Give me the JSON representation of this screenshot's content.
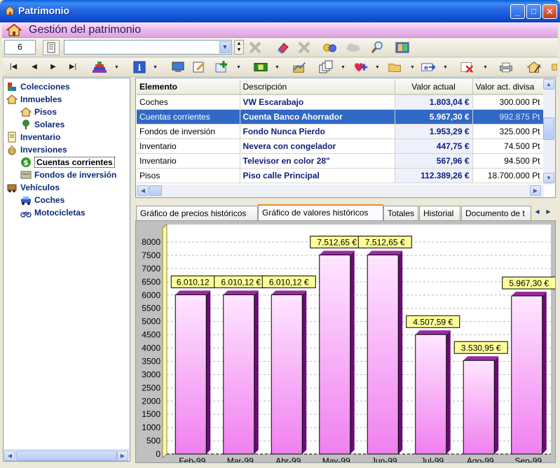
{
  "window": {
    "title": "Patrimonio",
    "min": "_",
    "max": "□",
    "close": "✕"
  },
  "header": {
    "title": "Gestión del patrimonio"
  },
  "toolbar1": {
    "count": "6",
    "combo_value": ""
  },
  "tree": {
    "items": [
      {
        "label": "Colecciones",
        "icon": "collections-icon",
        "level": 0
      },
      {
        "label": "Inmuebles",
        "icon": "house-icon",
        "level": 0
      },
      {
        "label": "Pisos",
        "icon": "house-icon",
        "level": 1
      },
      {
        "label": "Solares",
        "icon": "tree-icon",
        "level": 1
      },
      {
        "label": "Inventario",
        "icon": "inventory-icon",
        "level": 0
      },
      {
        "label": "Inversiones",
        "icon": "money-bag-icon",
        "level": 0
      },
      {
        "label": "Cuentas corrientes",
        "icon": "dollar-icon",
        "level": 1,
        "selected": true
      },
      {
        "label": "Fondos de inversión",
        "icon": "fund-icon",
        "level": 1
      },
      {
        "label": "Vehículos",
        "icon": "vehicle-icon",
        "level": 0
      },
      {
        "label": "Coches",
        "icon": "car-icon",
        "level": 1
      },
      {
        "label": "Motocicletas",
        "icon": "motorcycle-icon",
        "level": 1
      }
    ]
  },
  "grid": {
    "columns": [
      "Elemento",
      "Descripción",
      "Valor actual",
      "Valor act. divisa"
    ],
    "rows": [
      {
        "elemento": "Coches",
        "descripcion": "VW Escarabajo",
        "valor": "1.803,04 €",
        "divisa": "300.000 Pt"
      },
      {
        "elemento": "Cuentas corrientes",
        "descripcion": "Cuenta Banco Ahorrador",
        "valor": "5.967,30 €",
        "divisa": "992.875 Pt",
        "selected": true
      },
      {
        "elemento": "Fondos de inversión",
        "descripcion": "Fondo Nunca Pierdo",
        "valor": "1.953,29 €",
        "divisa": "325.000 Pt"
      },
      {
        "elemento": "Inventario",
        "descripcion": "Nevera con congelador",
        "valor": "447,75 €",
        "divisa": "74.500 Pt"
      },
      {
        "elemento": "Inventario",
        "descripcion": "Televisor en color 28\"",
        "valor": "567,96 €",
        "divisa": "94.500 Pt"
      },
      {
        "elemento": "Pisos",
        "descripcion": "Piso calle Principal",
        "valor": "112.389,26 €",
        "divisa": "18.700.000 Pt"
      }
    ]
  },
  "tabs": [
    {
      "label": "Gráfico de precios históricos"
    },
    {
      "label": "Gráfico de valores históricos",
      "active": true
    },
    {
      "label": "Totales"
    },
    {
      "label": "Historial"
    },
    {
      "label": "Documento de t"
    }
  ],
  "colors": {
    "bar_top": "#ffe6ff",
    "bar_bottom": "#f080f0",
    "bar_side": "#6a0c72",
    "label_bg": "#ffff99",
    "selection": "#3169c6"
  },
  "chart_data": {
    "type": "bar",
    "categories": [
      "Feb-99",
      "Mar-99",
      "Abr-99",
      "May-99",
      "Jun-99",
      "Jul-99",
      "Ago-99",
      "Sep-99"
    ],
    "values": [
      6010.12,
      6010.12,
      6010.12,
      7512.65,
      7512.65,
      4507.59,
      3530.95,
      5967.3
    ],
    "data_labels": [
      "6.010,12",
      "6.010,12 €",
      "6.010,12 €",
      "7.512,65 €",
      "7.512,65 €",
      "4.507,59 €",
      "3.530,95 €",
      "5.967,30 €"
    ],
    "yticks": [
      0,
      500,
      1000,
      1500,
      2000,
      2500,
      3000,
      3500,
      4000,
      4500,
      5000,
      5500,
      6000,
      6500,
      7000,
      7500,
      8000
    ],
    "ylim": [
      0,
      8000
    ],
    "grid": true
  }
}
